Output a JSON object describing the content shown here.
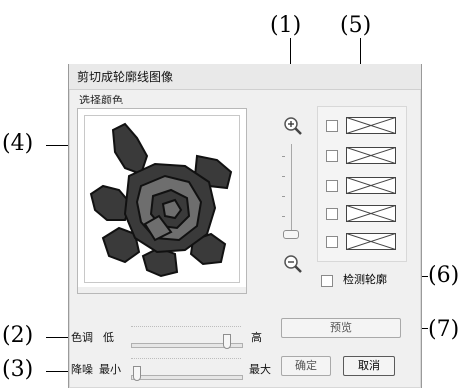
{
  "callouts": {
    "c1": "(1)",
    "c2": "(2)",
    "c3": "(3)",
    "c4": "(4)",
    "c5": "(5)",
    "c6": "(6)",
    "c7": "(7)"
  },
  "dialog": {
    "title": "剪切成轮廓线图像",
    "group_label": "选择颜色",
    "image_alt": "rose-embroidery-image"
  },
  "zoom": {
    "in_icon": "zoom-in-icon",
    "out_icon": "zoom-out-icon",
    "level": 0.95
  },
  "swatches": {
    "count": 5,
    "checked": [
      false,
      false,
      false,
      false,
      false
    ],
    "icon": "empty-swatch-x-icon"
  },
  "detect_outline": {
    "label": "检测轮廓",
    "checked": false
  },
  "buttons": {
    "preview": "预览",
    "ok": "确定",
    "cancel": "取消"
  },
  "tone": {
    "label": "色调",
    "min_label": "低",
    "max_label": "高",
    "value": 0.88
  },
  "noise": {
    "label": "降噪",
    "min_label": "最小",
    "max_label": "最大",
    "value": 0.04
  },
  "colors": {
    "rose_dark": "#3a3a3a",
    "rose_mid": "#6e6e6e",
    "rose_black": "#111111",
    "dialog_bg": "#f0f0f0"
  }
}
